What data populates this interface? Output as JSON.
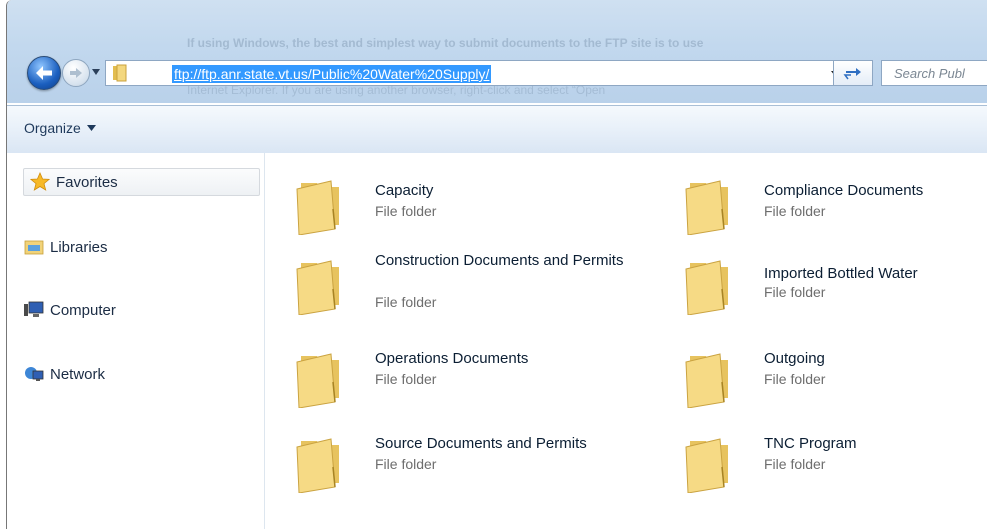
{
  "address": {
    "url": "ftp://ftp.anr.state.vt.us/Public%20Water%20Supply/",
    "search_placeholder": "Search Publ"
  },
  "background_text": {
    "line1": "If using Windows, the best and simplest way to submit documents to the FTP site is to use",
    "line2": "Internet Explorer. If you are using another browser, right-click and select “Open"
  },
  "command_bar": {
    "organize_label": "Organize"
  },
  "nav": {
    "items": [
      {
        "label": "Favorites",
        "icon": "star-icon"
      },
      {
        "label": "Libraries",
        "icon": "libraries-icon"
      },
      {
        "label": "Computer",
        "icon": "computer-icon"
      },
      {
        "label": "Network",
        "icon": "network-icon"
      }
    ]
  },
  "folders": [
    {
      "name": "Capacity",
      "type": "File folder"
    },
    {
      "name": "Compliance Documents",
      "type": "File folder"
    },
    {
      "name": "Construction Documents and Permits",
      "type": "File folder"
    },
    {
      "name": "Imported Bottled Water",
      "type": "File folder"
    },
    {
      "name": "Operations Documents",
      "type": "File folder"
    },
    {
      "name": "Outgoing",
      "type": "File folder"
    },
    {
      "name": "Source Documents and Permits",
      "type": "File folder"
    },
    {
      "name": "TNC Program",
      "type": "File folder"
    }
  ],
  "colors": {
    "selection": "#3399ff",
    "frame": "#c2d8ee",
    "folder": "#f0d27a"
  }
}
